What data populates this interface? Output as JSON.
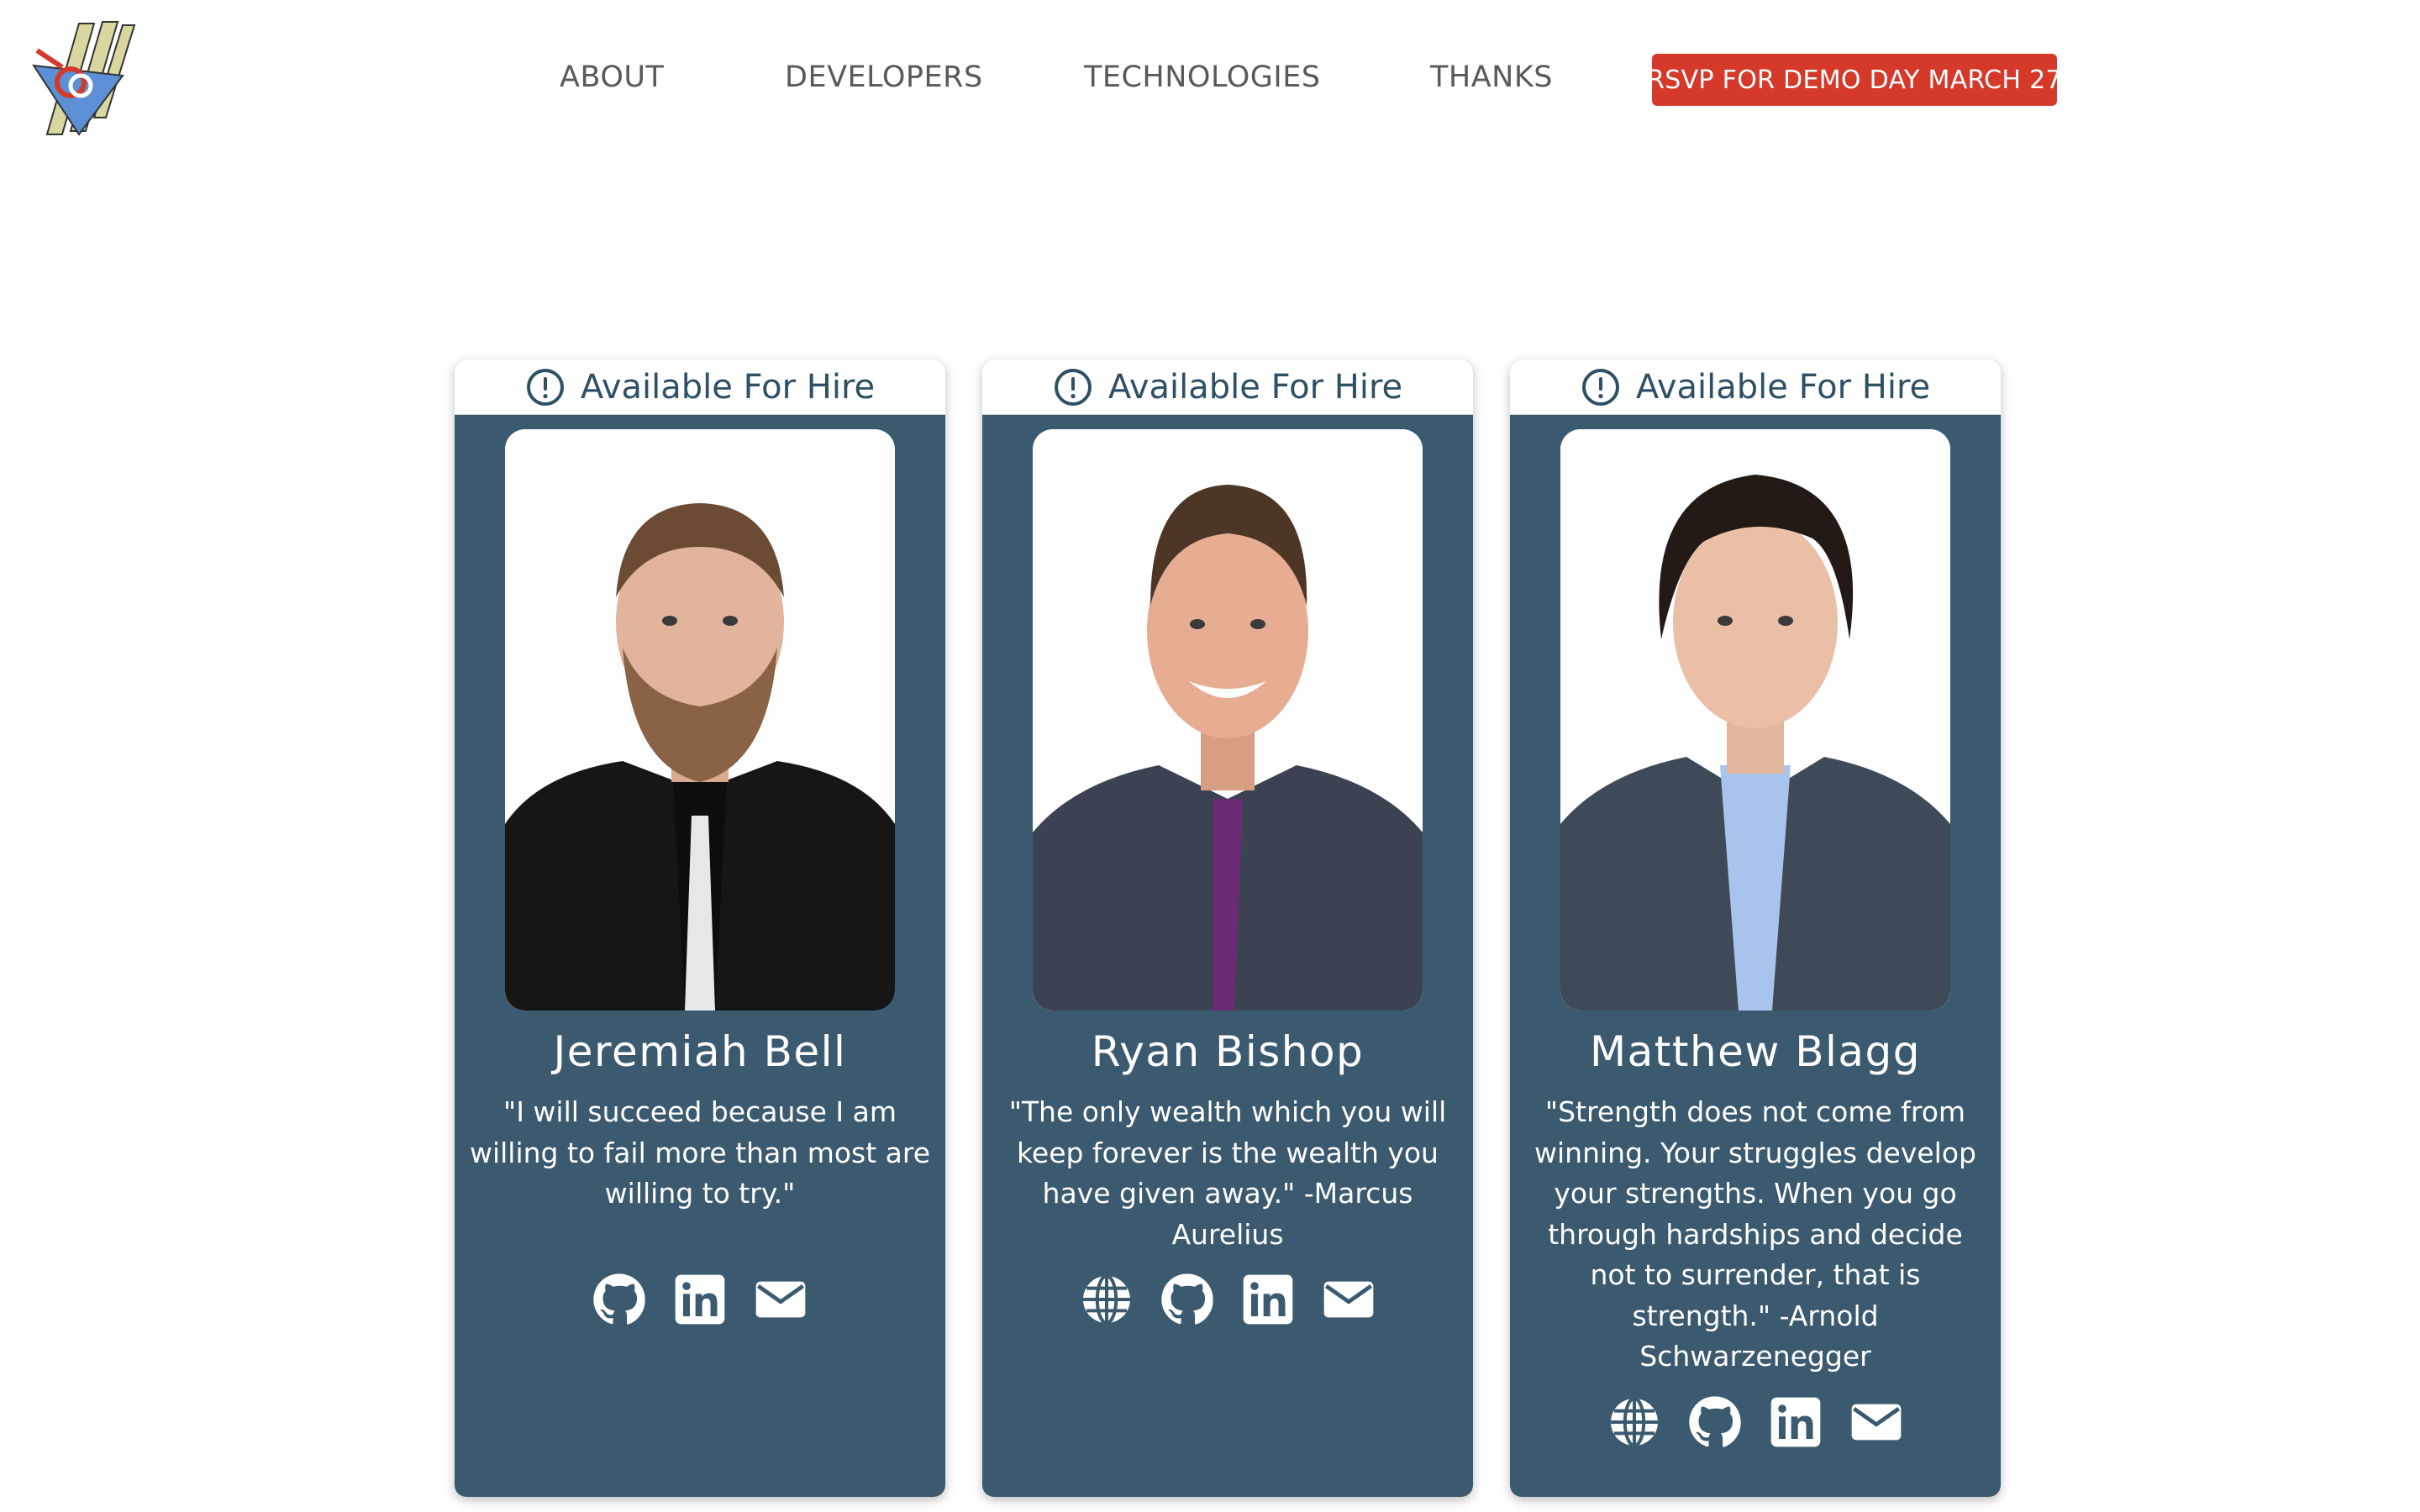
{
  "nav": {
    "links": [
      "ABOUT",
      "DEVELOPERS",
      "TECHNOLOGIES",
      "THANKS"
    ],
    "rsvp_label": "RSVP FOR DEMO DAY MARCH 27"
  },
  "colors": {
    "card_bg": "#3b5a6f",
    "rsvp_bg": "#d5392a",
    "banner_text": "#2e5065"
  },
  "developers": [
    {
      "banner": "Available For Hire",
      "name": "Jeremiah Bell",
      "quote": "\"I will succeed because I am willing to fail more than most are willing to try.\"",
      "icons": [
        "github-icon",
        "linkedin-icon",
        "email-icon"
      ]
    },
    {
      "banner": "Available For Hire",
      "name": "Ryan Bishop",
      "quote": "\"The only wealth which you will keep forever is the wealth you have given away.\" -Marcus Aurelius",
      "icons": [
        "globe-icon",
        "github-icon",
        "linkedin-icon",
        "email-icon"
      ]
    },
    {
      "banner": "Available For Hire",
      "name": "Matthew Blagg",
      "quote": "\"Strength does not come from winning. Your struggles develop your strengths. When you go through hardships and decide not to surrender, that is strength.\" -Arnold Schwarzenegger",
      "icons": [
        "globe-icon",
        "github-icon",
        "linkedin-icon",
        "email-icon"
      ]
    }
  ]
}
